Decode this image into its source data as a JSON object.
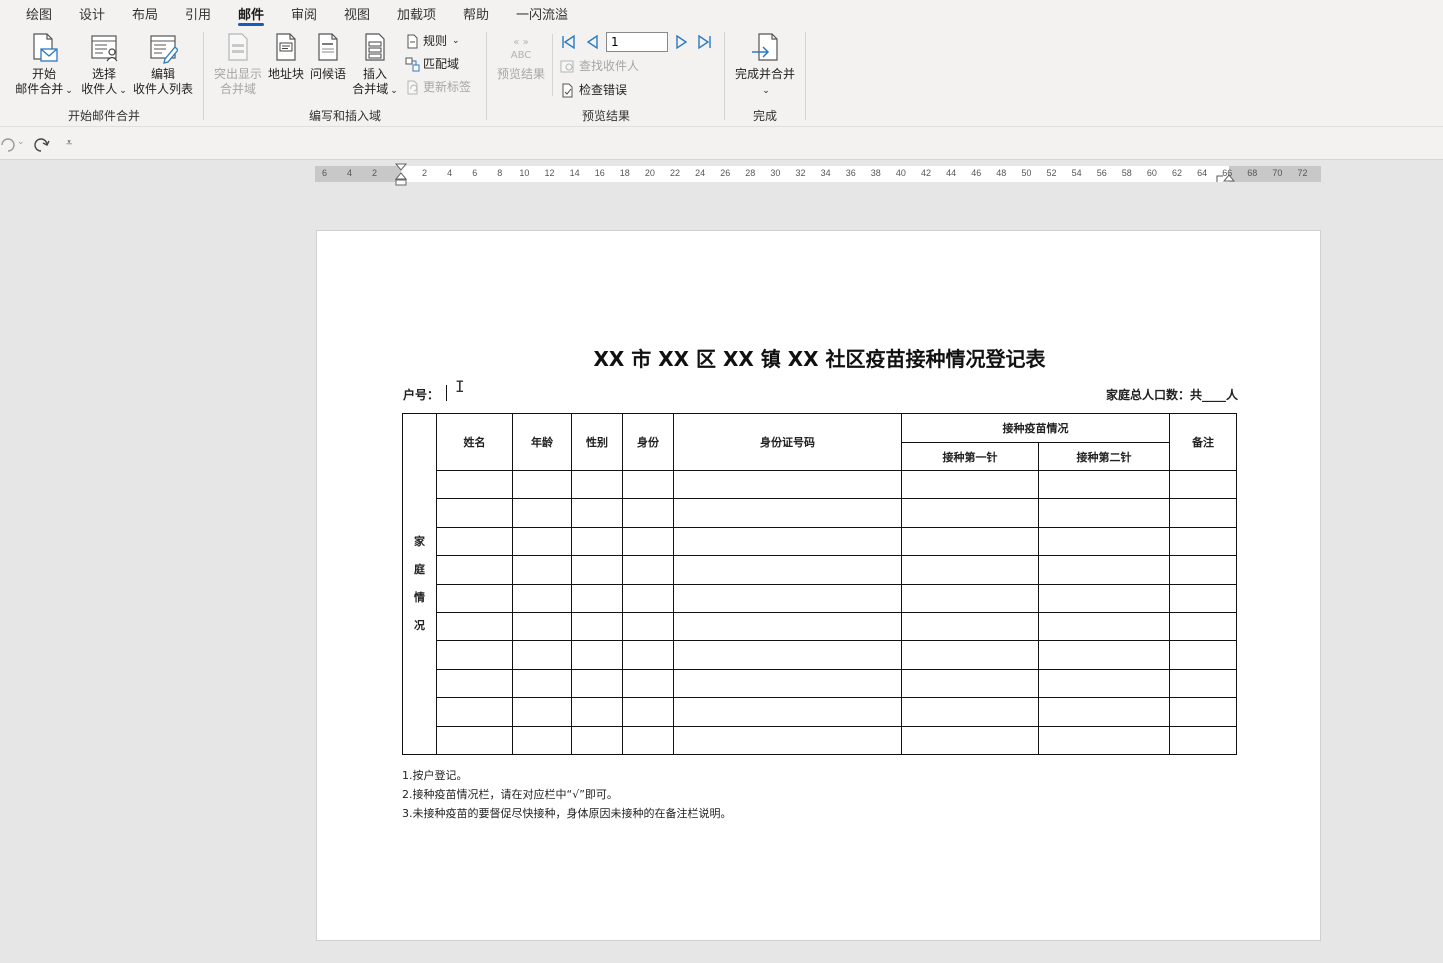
{
  "tabs": [
    {
      "label": "绘图",
      "active": false
    },
    {
      "label": "设计",
      "active": false
    },
    {
      "label": "布局",
      "active": false
    },
    {
      "label": "引用",
      "active": false
    },
    {
      "label": "邮件",
      "active": true
    },
    {
      "label": "审阅",
      "active": false
    },
    {
      "label": "视图",
      "active": false
    },
    {
      "label": "加载项",
      "active": false
    },
    {
      "label": "帮助",
      "active": false
    },
    {
      "label": "一闪流溢",
      "active": false
    }
  ],
  "ribbon": {
    "groups": {
      "start": "开始邮件合并",
      "write": "编写和插入域",
      "preview": "预览结果",
      "finish": "完成"
    },
    "start_mail_merge": {
      "line1": "开始",
      "line2": "邮件合并"
    },
    "select_recipients": {
      "line1": "选择",
      "line2": "收件人"
    },
    "edit_recipients": {
      "line1": "编辑",
      "line2": "收件人列表"
    },
    "highlight_fields": {
      "line1": "突出显示",
      "line2": "合并域"
    },
    "address_block": "地址块",
    "greeting_line": "问候语",
    "insert_field": {
      "line1": "插入",
      "line2": "合并域"
    },
    "rules": "规则",
    "match_fields": "匹配域",
    "update_labels": "更新标签",
    "preview_results": "预览结果",
    "preview_icon_text": "ABC",
    "record_number": "1",
    "find_recipient": "查找收件人",
    "check_errors": "检查错误",
    "finish_merge": "完成并合并"
  },
  "ruler": {
    "left_ticks": [
      "6",
      "4",
      "2"
    ],
    "ticks": [
      "2",
      "4",
      "6",
      "8",
      "10",
      "12",
      "14",
      "16",
      "18",
      "20",
      "22",
      "24",
      "26",
      "28",
      "30",
      "32",
      "34",
      "36",
      "38",
      "40",
      "42",
      "44",
      "46",
      "48",
      "50",
      "52",
      "54",
      "56",
      "58",
      "60",
      "62",
      "64",
      "66",
      "68",
      "70",
      "72"
    ]
  },
  "document": {
    "title": "XX 市 XX 区 XX 镇 XX 社区疫苗接种情况登记表",
    "household_label": "户号：",
    "population_label": "家庭总人口数：共____人",
    "table": {
      "side_label": [
        "家",
        "庭",
        "情",
        "况"
      ],
      "headers": {
        "name": "姓名",
        "age": "年龄",
        "gender": "性别",
        "identity": "身份",
        "id_number": "身份证号码",
        "vaccination": "接种疫苗情况",
        "first_dose": "接种第一针",
        "second_dose": "接种第二针",
        "remarks": "备注"
      },
      "empty_rows": 10
    },
    "notes": [
      "1.按户登记。",
      "2.接种疫苗情况栏，请在对应栏中“√”即可。",
      "3.未接种疫苗的要督促尽快接种，身体原因未接种的在备注栏说明。"
    ]
  }
}
